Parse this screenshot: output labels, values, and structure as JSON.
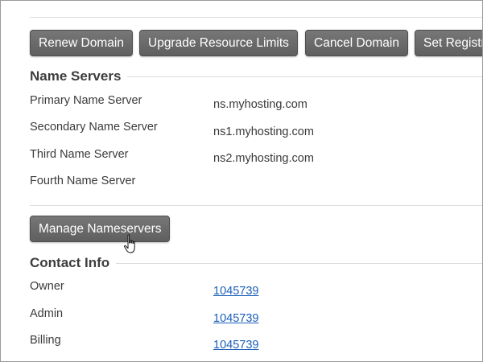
{
  "toolbar": {
    "renew_label": "Renew Domain",
    "upgrade_label": "Upgrade Resource Limits",
    "cancel_label": "Cancel Domain",
    "registrar_label": "Set Registrar"
  },
  "name_servers": {
    "title": "Name Servers",
    "rows": [
      {
        "label": "Primary Name Server",
        "value": "ns.myhosting.com"
      },
      {
        "label": "Secondary Name Server",
        "value": "ns1.myhosting.com"
      },
      {
        "label": "Third Name Server",
        "value": "ns2.myhosting.com"
      },
      {
        "label": "Fourth Name Server",
        "value": ""
      }
    ],
    "manage_label": "Manage Nameservers"
  },
  "contact_info": {
    "title": "Contact Info",
    "rows": [
      {
        "label": "Owner",
        "value": "1045739"
      },
      {
        "label": "Admin",
        "value": "1045739"
      },
      {
        "label": "Billing",
        "value": "1045739"
      }
    ]
  },
  "icons": {
    "cursor": "hand-pointer-icon"
  },
  "colors": {
    "button_bg": "#696969",
    "link": "#1a5fb8",
    "text": "#3a3a3a"
  }
}
